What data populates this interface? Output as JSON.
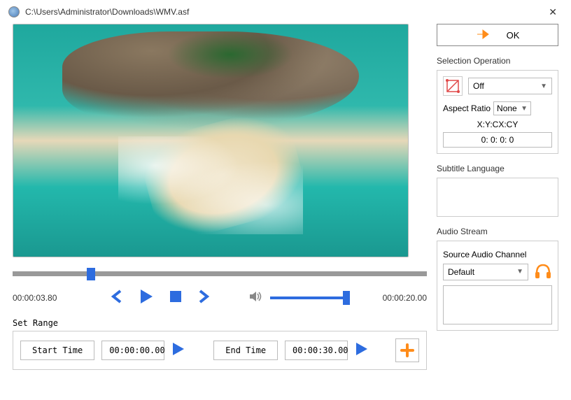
{
  "window": {
    "title": "C:\\Users\\Administrator\\Downloads\\WMV.asf"
  },
  "ok_button": {
    "label": "OK"
  },
  "playback": {
    "current_time": "00:00:03.80",
    "total_time": "00:00:20.00"
  },
  "range": {
    "section_label": "Set Range",
    "start_button": "Start Time",
    "start_value": "00:00:00.00",
    "end_button": "End Time",
    "end_value": "00:00:30.00"
  },
  "selection": {
    "title": "Selection Operation",
    "mode": "Off",
    "aspect_label": "Aspect Ratio",
    "aspect_value": "None",
    "xy_label": "X:Y:CX:CY",
    "xy_value": "0: 0: 0: 0"
  },
  "subtitle": {
    "title": "Subtitle Language"
  },
  "audio": {
    "title": "Audio Stream",
    "channel_label": "Source Audio Channel",
    "channel_value": "Default"
  }
}
